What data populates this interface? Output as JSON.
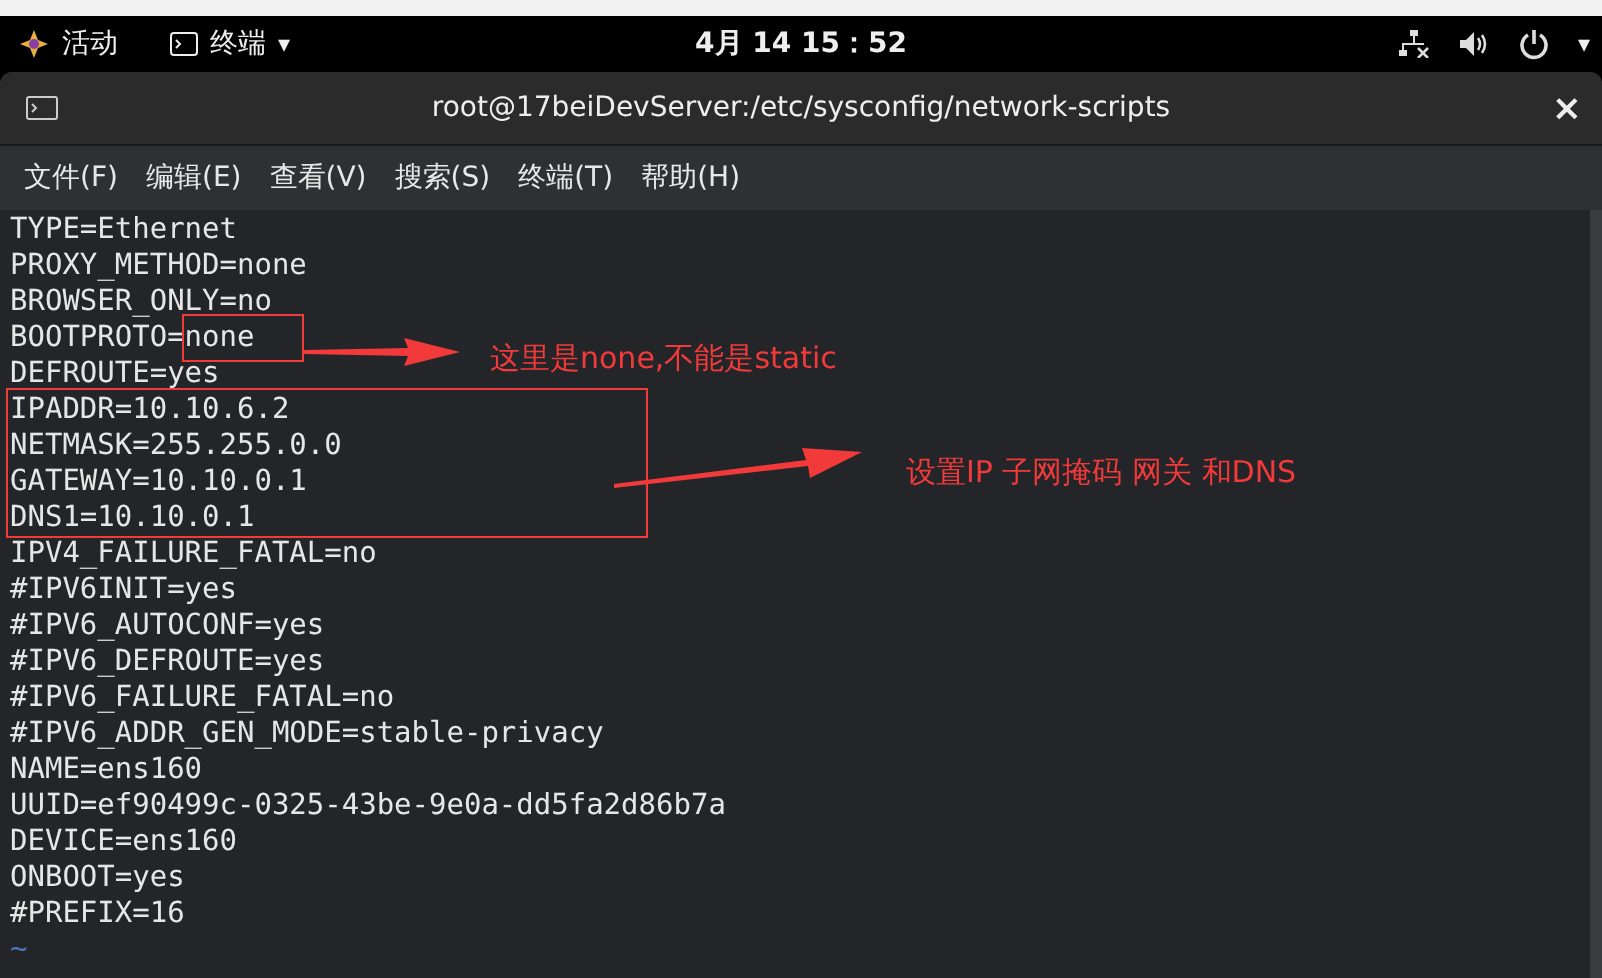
{
  "top_bar": {
    "activities": "活动",
    "app_menu": "终端",
    "app_menu_caret": "▾",
    "clock": "4月 14  15：52",
    "menu_caret": "▾"
  },
  "window": {
    "title": "root@17beiDevServer:/etc/sysconfig/network-scripts",
    "close": "×",
    "menu": [
      "文件(F)",
      "编辑(E)",
      "查看(V)",
      "搜索(S)",
      "终端(T)",
      "帮助(H)"
    ],
    "lines": [
      "TYPE=Ethernet",
      "PROXY_METHOD=none",
      "BROWSER_ONLY=no",
      "BOOTPROTO=none",
      "DEFROUTE=yes",
      "IPADDR=10.10.6.2",
      "NETMASK=255.255.0.0",
      "GATEWAY=10.10.0.1",
      "DNS1=10.10.0.1",
      "IPV4_FAILURE_FATAL=no",
      "#IPV6INIT=yes",
      "#IPV6_AUTOCONF=yes",
      "#IPV6_DEFROUTE=yes",
      "#IPV6_FAILURE_FATAL=no",
      "#IPV6_ADDR_GEN_MODE=stable-privacy",
      "NAME=ens160",
      "UUID=ef90499c-0325-43be-9e0a-dd5fa2d86b7a",
      "DEVICE=ens160",
      "ONBOOT=yes",
      "#PREFIX=16"
    ],
    "empty_line_marker": "~"
  },
  "annotations": [
    {
      "text": "这里是none,不能是static"
    },
    {
      "text": "设置IP 子网掩码 网关 和DNS"
    }
  ]
}
